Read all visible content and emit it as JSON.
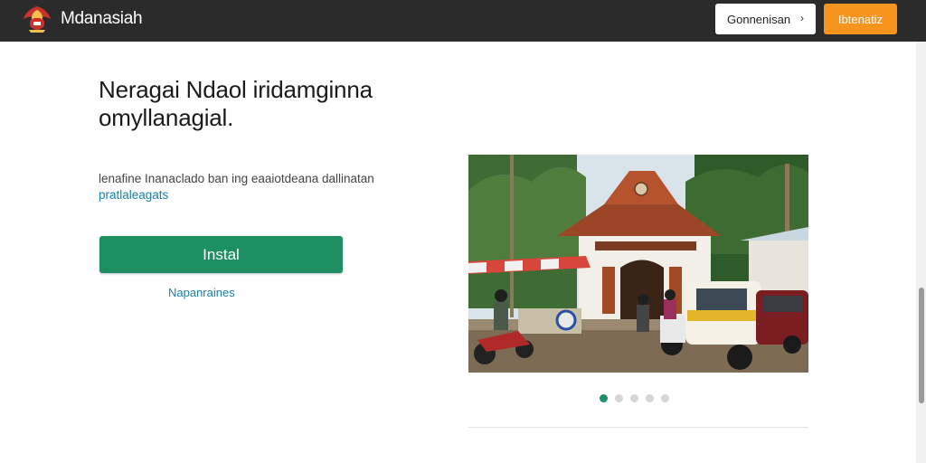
{
  "header": {
    "brand": "Mdanasiah",
    "secondary_button": "Gonnenisan",
    "primary_button": "Ibtenatiz"
  },
  "hero": {
    "headline": "Neragai Ndaol iridamginna omyllanagial.",
    "description": "lenafine Inanaclado ban ing eaaiotdeana dallinatan",
    "description_link": "pratlaleagats",
    "install_label": "Instal",
    "secondary_link": "Napanraines"
  },
  "carousel": {
    "slide_count": 5,
    "active_index": 0
  },
  "colors": {
    "topbar": "#2b2b2b",
    "accent_orange": "#f7941d",
    "install_green": "#1e8f63",
    "link_blue": "#1c7fa6"
  },
  "icons": {
    "logo": "garuda-emblem-icon",
    "secondary_button_icon": "chevron-right-icon"
  }
}
